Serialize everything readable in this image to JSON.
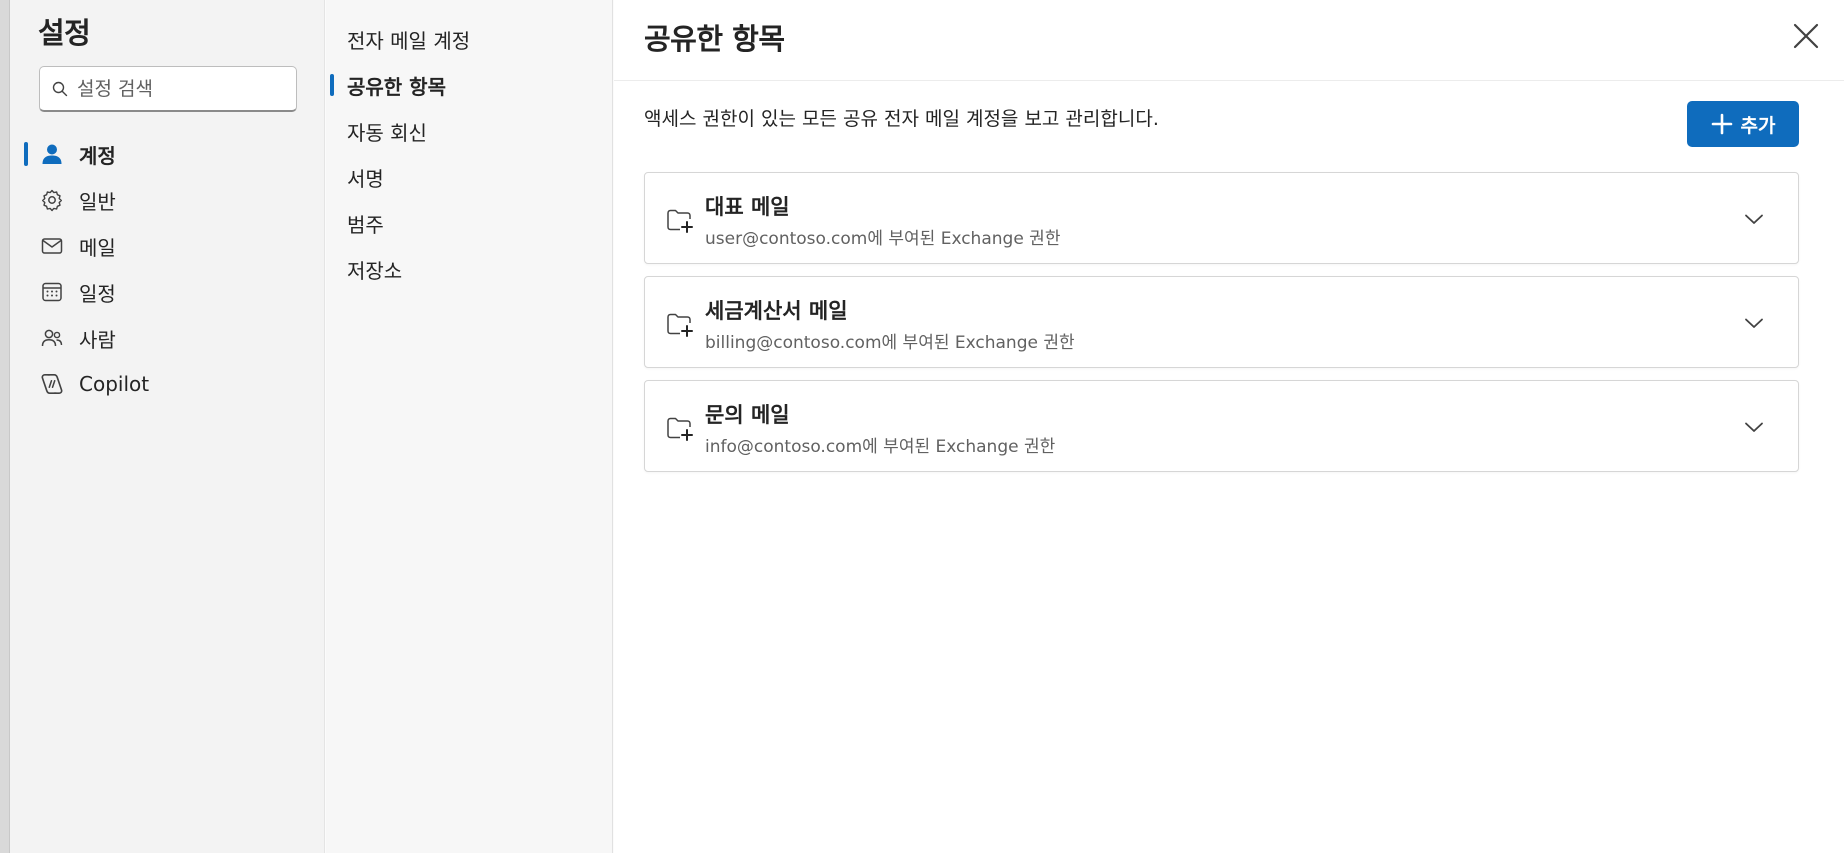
{
  "nav": {
    "title": "설정",
    "search": {
      "placeholder": "설정 검색",
      "value": ""
    },
    "items": [
      {
        "label": "계정",
        "icon": "person-icon",
        "active": true
      },
      {
        "label": "일반",
        "icon": "gear-icon",
        "active": false
      },
      {
        "label": "메일",
        "icon": "mail-icon",
        "active": false
      },
      {
        "label": "일정",
        "icon": "calendar-icon",
        "active": false
      },
      {
        "label": "사람",
        "icon": "people-icon",
        "active": false
      },
      {
        "label": "Copilot",
        "icon": "copilot-icon",
        "active": false
      }
    ]
  },
  "subnav": {
    "items": [
      {
        "label": "전자 메일 계정",
        "active": false
      },
      {
        "label": "공유한 항목",
        "active": true
      },
      {
        "label": "자동 회신",
        "active": false
      },
      {
        "label": "서명",
        "active": false
      },
      {
        "label": "범주",
        "active": false
      },
      {
        "label": "저장소",
        "active": false
      }
    ]
  },
  "main": {
    "title": "공유한 항목",
    "description": "액세스 권한이 있는 모든 공유 전자 메일 계정을 보고 관리합니다.",
    "add_label": "추가",
    "accounts": [
      {
        "name": "대표 메일",
        "detail": "user@contoso.com에 부여된 Exchange 권한"
      },
      {
        "name": "세금계산서 메일",
        "detail": "billing@contoso.com에 부여된 Exchange 권한"
      },
      {
        "name": "문의 메일",
        "detail": "info@contoso.com에 부여된 Exchange 권한"
      }
    ]
  },
  "colors": {
    "accent": "#0f6cbd",
    "text": "#242424",
    "secondary_text": "#616161"
  }
}
